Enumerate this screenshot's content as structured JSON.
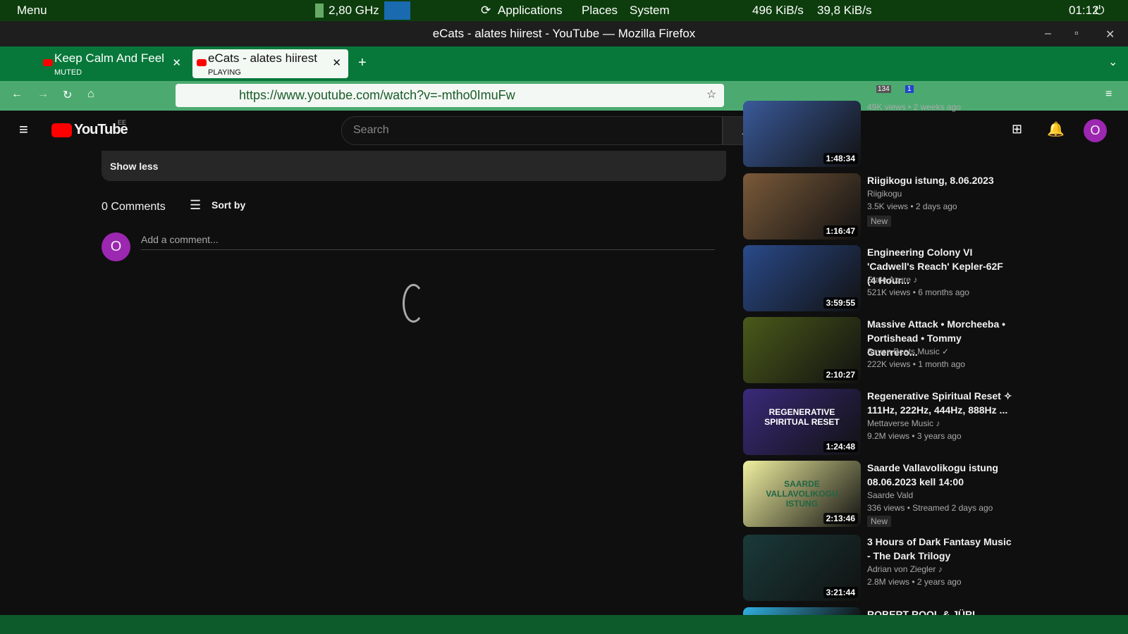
{
  "panel": {
    "menu": "Menu",
    "cpu": "2,80 GHz",
    "apps": "Applications",
    "places": "Places",
    "system": "System",
    "net": "496 KiB/s",
    "net_up": "39,8 KiB/s",
    "clock": "01:12"
  },
  "window": {
    "title": "eCats - alates hiirest - YouTube — Mozilla Firefox"
  },
  "tabs": [
    {
      "title": "Keep Calm And Feel",
      "status": "MUTED"
    },
    {
      "title": "eCats - alates hiirest",
      "status": "PLAYING"
    }
  ],
  "url": "https://www.youtube.com/watch?v=-mtho0ImuFw",
  "ext_badges": {
    "ublock": "134",
    "other": "1"
  },
  "youtube": {
    "logo": "YouTube",
    "region": "EE",
    "search_placeholder": "Search",
    "avatar": "O"
  },
  "main": {
    "show_less": "Show less",
    "comments_count": "0 Comments",
    "sort_by": "Sort by",
    "add_comment": "Add a comment...",
    "avatar": "O"
  },
  "sidebar": [
    {
      "title": "",
      "channel": "",
      "meta": "49K views • 2 weeks ago",
      "duration": "1:48:34",
      "badge": "",
      "color": "#3a5a9a"
    },
    {
      "title": "Riigikogu istung, 8.06.2023",
      "channel": "Riigikogu",
      "meta": "3.5K views • 2 days ago",
      "duration": "1:16:47",
      "badge": "New",
      "color": "#7a5a3a"
    },
    {
      "title": "Engineering Colony VI 'Cadwell's Reach' Kepler-62F (4 Hour...",
      "channel": "State Azure ♪",
      "meta": "521K views • 6 months ago",
      "duration": "3:59:55",
      "badge": "",
      "color": "#2a4a8a"
    },
    {
      "title": "Massive Attack • Morcheeba • Portishead • Tommy Guerrero...",
      "channel": "Seven Beats Music ✓",
      "meta": "222K views • 1 month ago",
      "duration": "2:10:27",
      "badge": "",
      "color": "#4a5a1a"
    },
    {
      "title": "Regenerative Spiritual Reset ✧ 111Hz, 222Hz, 444Hz, 888Hz ...",
      "channel": "Mettaverse Music ♪",
      "meta": "9.2M views • 3 years ago",
      "duration": "1:24:48",
      "badge": "",
      "color": "#3a2a7a",
      "thumb_text": "REGENERATIVE SPIRITUAL RESET"
    },
    {
      "title": "Saarde Vallavolikogu istung 08.06.2023 kell 14:00",
      "channel": "Saarde Vald",
      "meta": "336 views • Streamed 2 days ago",
      "duration": "2:13:46",
      "badge": "New",
      "color": "#f0f0a0",
      "thumb_text": "SAARDE VALLAVOLIKOGU ISTUNG"
    },
    {
      "title": "3 Hours of Dark Fantasy Music - The Dark Trilogy",
      "channel": "Adrian von Ziegler ♪",
      "meta": "2.8M views • 2 years ago",
      "duration": "3:21:44",
      "badge": "",
      "color": "#1a3a3a"
    },
    {
      "title": "ROBERT ROOL & JÜRI",
      "channel": "",
      "meta": "",
      "duration": "",
      "badge": "",
      "color": "#30b0e0"
    }
  ]
}
